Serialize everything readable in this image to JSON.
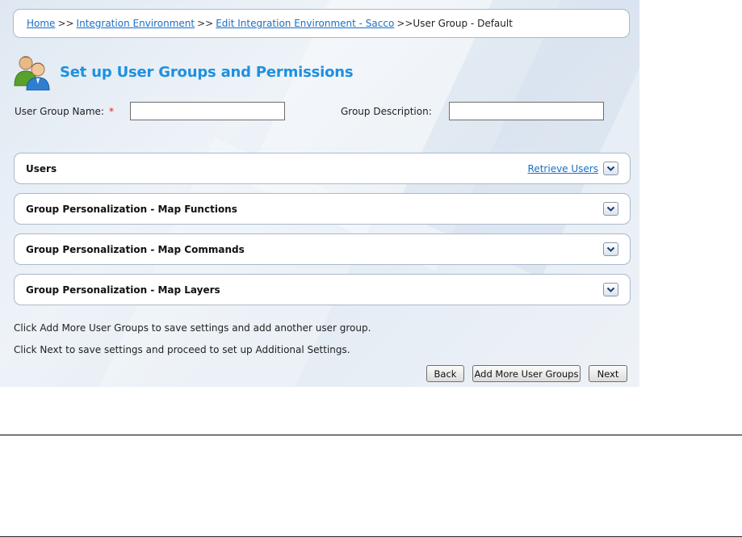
{
  "breadcrumb": {
    "items": [
      {
        "label": "Home"
      },
      {
        "label": "Integration Environment"
      },
      {
        "label": "Edit Integration Environment - Sacco"
      }
    ],
    "separator": ">>",
    "current": "User Group - Default"
  },
  "page": {
    "title": "Set up User Groups and Permissions",
    "icon": "users-group-icon"
  },
  "form": {
    "group_name_label": "User Group Name:",
    "required_mark": "*",
    "group_name_value": "",
    "group_description_label": "Group Description:",
    "group_description_value": ""
  },
  "panels": {
    "users": {
      "title": "Users",
      "link": "Retrieve Users"
    },
    "map_functions": {
      "title": "Group Personalization - Map Functions"
    },
    "map_commands": {
      "title": "Group Personalization - Map Commands"
    },
    "map_layers": {
      "title": "Group Personalization - Map Layers"
    }
  },
  "info": {
    "line1": "Click Add More User Groups to save settings and add another user group.",
    "line2": "Click Next to save settings and proceed to set up Additional Settings."
  },
  "buttons": {
    "back": "Back",
    "add_more": "Add More User Groups",
    "next": "Next"
  },
  "colors": {
    "title": "#1e90e0",
    "link": "#1a6fc4",
    "required": "#e02020",
    "panel_border": "#a9b9cc"
  }
}
